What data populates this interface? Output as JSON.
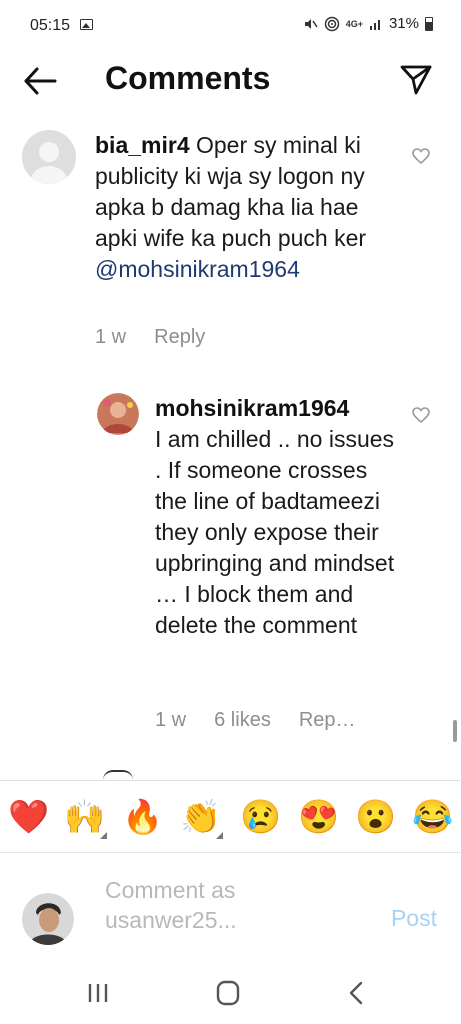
{
  "status_bar": {
    "time": "05:15",
    "battery": "31%",
    "network": "4G+",
    "icons": [
      "image-icon",
      "mute-icon",
      "wifi-calling-icon",
      "signal-icon",
      "battery-icon"
    ]
  },
  "header": {
    "title": "Comments",
    "icons": [
      "back-arrow-icon",
      "send-icon"
    ]
  },
  "comments": [
    {
      "username": "bia_mir4",
      "text": "Oper sy minal ki publicity ki wja sy logon ny apka b damag kha lia hae apki wife ka puch puch ker",
      "mention": "@mohsinikram1964",
      "time": "1 w",
      "reply_label": "Reply"
    },
    {
      "username": "mohsinikram1964",
      "text": "I am chilled .. no issues . If someone crosses the line of badtameezi they only expose their upbringing and mindset … I block them and delete the comment",
      "time": "1 w",
      "likes": "6 likes",
      "reply_label": "Rep…"
    }
  ],
  "emoji_bar": [
    "❤️",
    "🙌",
    "🔥",
    "👏",
    "😢",
    "😍",
    "😮",
    "😂"
  ],
  "composer": {
    "placeholder": "Comment as usanwer25...",
    "post_label": "Post"
  },
  "nav_bar": [
    "recent-apps-icon",
    "home-icon",
    "back-icon"
  ],
  "colors": {
    "mention": "#1d3b70",
    "meta": "#8e8e8e",
    "post_disabled": "#a8d2f5"
  }
}
